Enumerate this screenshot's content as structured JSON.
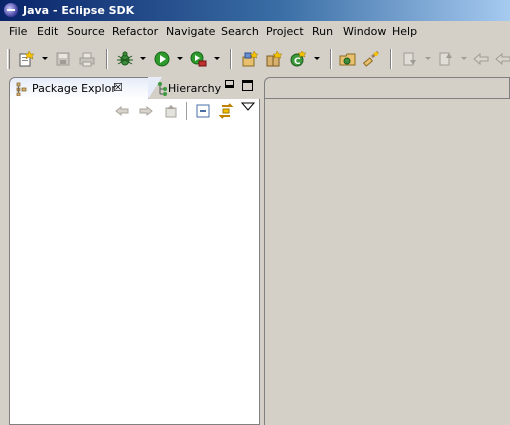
{
  "window": {
    "title": "Java - Eclipse SDK"
  },
  "menu": [
    "File",
    "Edit",
    "Source",
    "Refactor",
    "Navigate",
    "Search",
    "Project",
    "Run",
    "Window",
    "Help"
  ],
  "toolbar": {
    "icons": [
      "new-wizard-icon",
      "save-icon",
      "print-icon",
      "debug-icon",
      "run-icon",
      "external-tools-icon",
      "new-java-project-icon",
      "new-package-icon",
      "new-class-icon",
      "open-type-icon",
      "search-icon",
      "next-annotation-icon",
      "previous-annotation-icon",
      "back-icon",
      "forward-icon"
    ]
  },
  "package_explorer": {
    "tabs": [
      {
        "label": "Package Explor",
        "icon": "package-explorer-icon",
        "active": true
      },
      {
        "label": "Hierarchy",
        "icon": "hierarchy-icon",
        "active": false
      }
    ],
    "close_glyph": "☒",
    "view_toolbar_icons": [
      "back-icon",
      "forward-icon",
      "up-icon",
      "collapse-all-icon",
      "link-with-editor-icon",
      "view-menu-icon"
    ]
  },
  "colors": {
    "title_start": "#0a246a",
    "title_end": "#a6caf0",
    "chrome": "#d4d0c8",
    "view_bg": "#ffffff"
  }
}
